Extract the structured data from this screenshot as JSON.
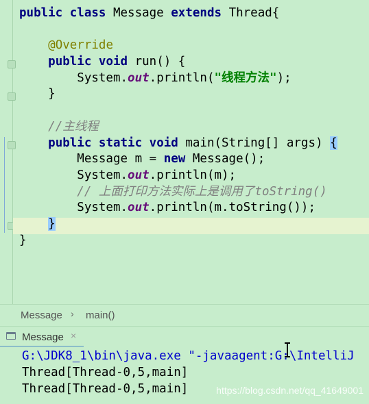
{
  "editor": {
    "lines": [
      [
        {
          "t": "public class ",
          "c": "kw"
        },
        {
          "t": "Message ",
          "c": ""
        },
        {
          "t": "extends ",
          "c": "kw"
        },
        {
          "t": "Thread{",
          "c": ""
        }
      ],
      [],
      [
        {
          "t": "    ",
          "c": ""
        },
        {
          "t": "@Override",
          "c": "ann"
        }
      ],
      [
        {
          "t": "    ",
          "c": ""
        },
        {
          "t": "public void ",
          "c": "kw"
        },
        {
          "t": "run() {",
          "c": ""
        }
      ],
      [
        {
          "t": "        System.",
          "c": ""
        },
        {
          "t": "out",
          "c": "fld"
        },
        {
          "t": ".println(",
          "c": ""
        },
        {
          "t": "\"线程方法\"",
          "c": "str"
        },
        {
          "t": ");",
          "c": ""
        }
      ],
      [
        {
          "t": "    }",
          "c": ""
        }
      ],
      [],
      [
        {
          "t": "    ",
          "c": ""
        },
        {
          "t": "//主线程",
          "c": "cmt"
        }
      ],
      [
        {
          "t": "    ",
          "c": ""
        },
        {
          "t": "public static void ",
          "c": "kw"
        },
        {
          "t": "main(String[] args) ",
          "c": ""
        },
        {
          "t": "{",
          "c": "brace-hl"
        }
      ],
      [
        {
          "t": "        Message m = ",
          "c": ""
        },
        {
          "t": "new ",
          "c": "kw"
        },
        {
          "t": "Message();",
          "c": ""
        }
      ],
      [
        {
          "t": "        System.",
          "c": ""
        },
        {
          "t": "out",
          "c": "fld"
        },
        {
          "t": ".println(m);",
          "c": ""
        }
      ],
      [
        {
          "t": "        ",
          "c": ""
        },
        {
          "t": "// 上面打印方法实际上是调用了toString()",
          "c": "cmt"
        }
      ],
      [
        {
          "t": "        System.",
          "c": ""
        },
        {
          "t": "out",
          "c": "fld"
        },
        {
          "t": ".println(m.toString());",
          "c": ""
        }
      ],
      [
        {
          "t": "    ",
          "c": ""
        },
        {
          "t": "}",
          "c": "brace-hl"
        }
      ],
      [
        {
          "t": "}",
          "c": ""
        }
      ]
    ]
  },
  "breadcrumb": {
    "class_name": "Message",
    "separator": "›",
    "method_name": "main()"
  },
  "run_panel": {
    "tab_label": "Message",
    "close_glyph": "×",
    "console_lines": [
      {
        "text": "G:\\JDK8_1\\bin\\java.exe \"-javaagent:G:\\IntelliJ",
        "cls": "console-path"
      },
      {
        "text": "Thread[Thread-0,5,main]",
        "cls": ""
      },
      {
        "text": "Thread[Thread-0,5,main]",
        "cls": ""
      }
    ]
  },
  "watermark": "https://blog.csdn.net/qq_41649001",
  "colors": {
    "background": "#c7edcc",
    "keyword": "#000080",
    "string": "#008000",
    "field": "#660e7a",
    "comment": "#808080",
    "annotation": "#808000"
  },
  "icons": [
    "fold-marker-icon",
    "console-tab-icon",
    "close-icon",
    "text-cursor-icon"
  ]
}
